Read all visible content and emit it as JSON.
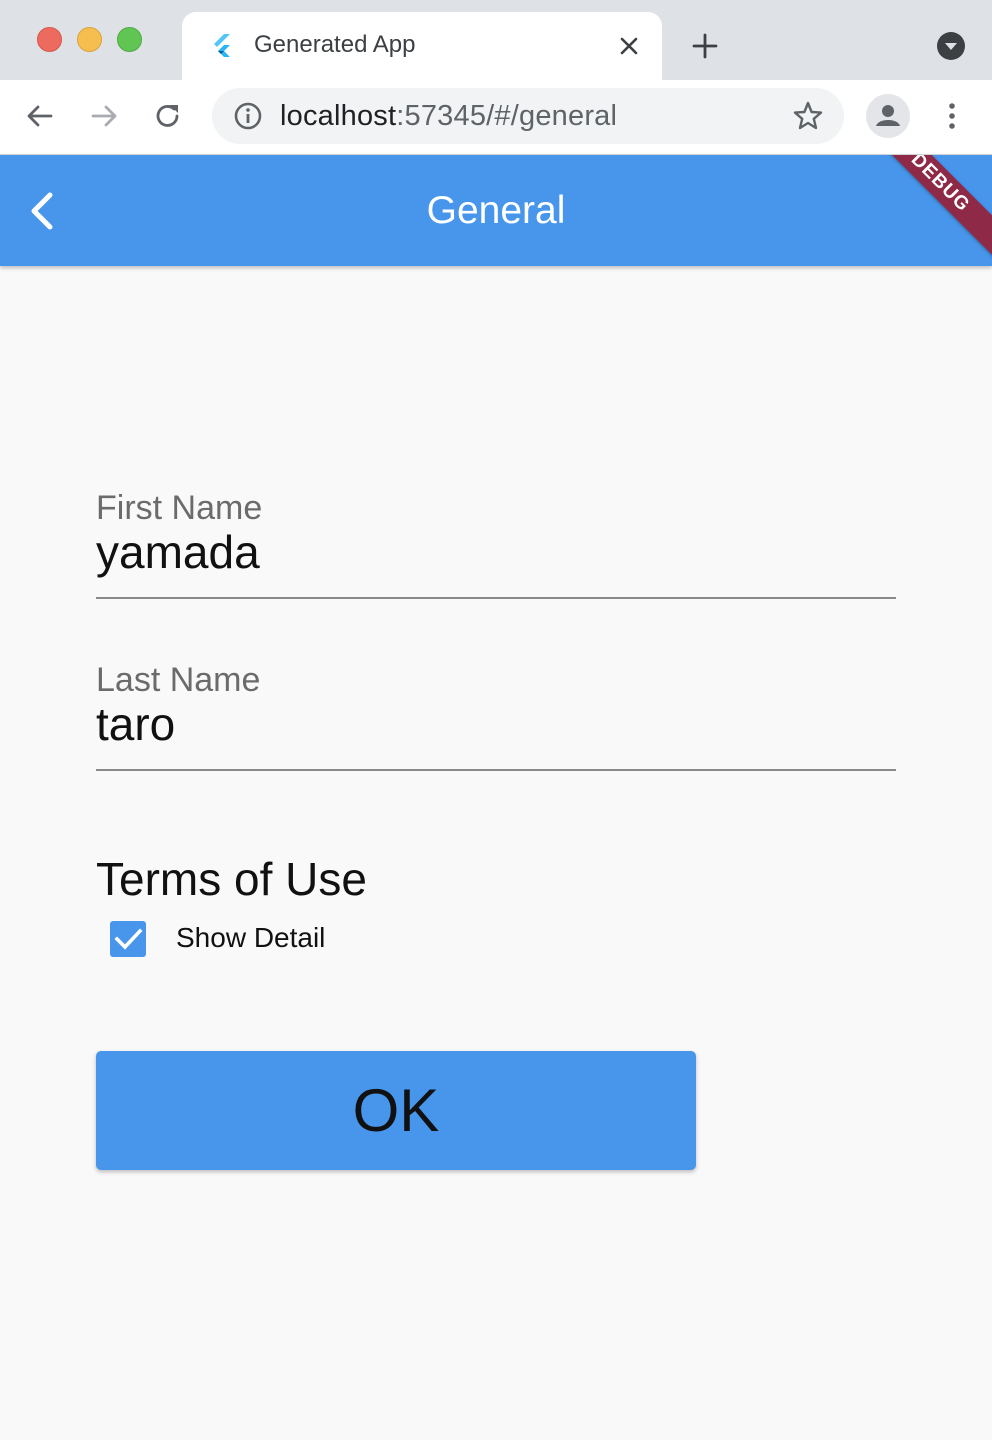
{
  "browser": {
    "tab_title": "Generated App",
    "url_host": "localhost",
    "url_rest": ":57345/#/general"
  },
  "appbar": {
    "title": "General",
    "debug_banner": "DEBUG"
  },
  "form": {
    "first_name": {
      "label": "First Name",
      "value": "yamada"
    },
    "last_name": {
      "label": "Last Name",
      "value": "taro"
    },
    "terms_title": "Terms of Use",
    "show_detail": {
      "label": "Show Detail",
      "checked": true
    },
    "ok_label": "OK"
  },
  "colors": {
    "primary": "#4796eb",
    "debug_banner": "#8e2a47",
    "background": "#f9f9f9"
  },
  "icons": [
    "flutter-icon",
    "close-icon",
    "plus-icon",
    "tab-search-icon",
    "back-arrow-icon",
    "forward-arrow-icon",
    "reload-icon",
    "info-icon",
    "star-icon",
    "profile-icon",
    "kebab-menu-icon",
    "chevron-left-icon",
    "checkmark-icon"
  ]
}
